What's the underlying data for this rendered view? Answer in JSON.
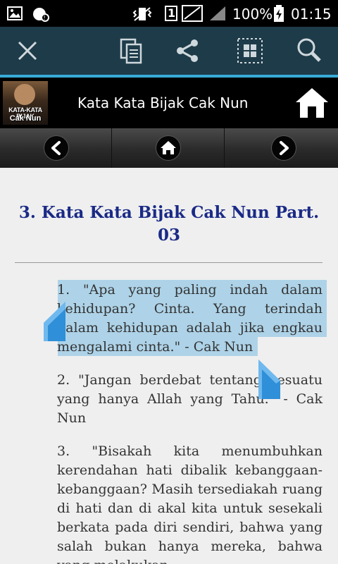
{
  "status_bar": {
    "sim_label": "1",
    "battery_percent": "100%",
    "time": "01:15"
  },
  "action_bar": {
    "icons": [
      "close-icon",
      "copy-icon",
      "share-icon",
      "select-all-icon",
      "search-icon"
    ]
  },
  "header": {
    "thumbnail_text_line1": "KATA-KATA BIJAK",
    "thumbnail_text_line2": "Cak Nun",
    "title": "Kata Kata Bijak Cak Nun"
  },
  "nav": {
    "icons": [
      "chevron-left-icon",
      "home-icon",
      "chevron-right-icon"
    ]
  },
  "article": {
    "title": "3. Kata Kata Bijak Cak Nun Part. 03",
    "quotes": [
      "1. \"Apa yang paling indah dalam kehidupan? Cinta. Yang terindah dalam kehidupan adalah jika engkau mengalami cinta.\" - Cak Nun",
      "2. \"Jangan berdebat tentang sesuatu yang hanya Allah yang Tahu.\" - Cak Nun",
      "3. \"Bisakah kita menumbuhkan kerendahan hati dibalik kebanggaan-kebanggaan? Masih tersediakah ruang di hati dan di akal kita untuk sesekali berkata pada diri sendiri, bahwa yang salah bukan hanya mereka, bahwa yang melakukan"
    ]
  },
  "colors": {
    "action_bar_bg": "#1e3b49",
    "accent_line": "#39a9d6",
    "title_color": "#1a2a86",
    "selection_highlight": "#aed3e8",
    "selection_handle": "#2f8fd8"
  }
}
